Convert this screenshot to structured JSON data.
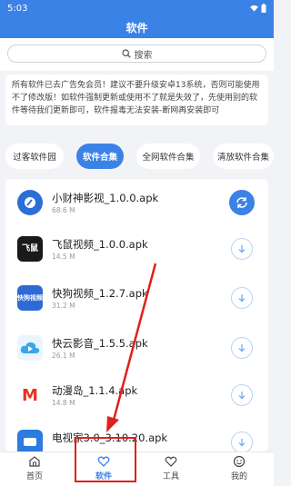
{
  "status_bar": {
    "time": "5:03"
  },
  "app_bar": {
    "title": "软件"
  },
  "search": {
    "placeholder": "搜索"
  },
  "notice": {
    "text": "所有软件已去广告免会员！建议不要升级安卓13系统，否则可能使用不了修改版！如软件强制更新或使用不了就是失效了，先使用别的软件等待我们更新即可，软件报毒无法安装-断网再安装即可"
  },
  "tabs": [
    {
      "label": "过客软件园"
    },
    {
      "label": "软件合集"
    },
    {
      "label": "全网软件合集"
    },
    {
      "label": "清放软件合集"
    }
  ],
  "apps": [
    {
      "name": "小财神影视_1.0.0.apk",
      "size": "68.6 M",
      "icon": "xiaocaishen-app-icon",
      "color": "#2b6fd6",
      "icon_text": "",
      "button": "sync"
    },
    {
      "name": "飞鼠视频_1.0.0.apk",
      "size": "14.5 M",
      "icon": "feishu-app-icon",
      "color": "#1a1a1a",
      "icon_text": "飞鼠",
      "button": "download"
    },
    {
      "name": "快狗视频_1.2.7.apk",
      "size": "31.2 M",
      "icon": "kuaigou-app-icon",
      "color": "#2d6ad3",
      "icon_text": "快狗视频",
      "button": "download"
    },
    {
      "name": "快云影音_1.5.5.apk",
      "size": "26.1 M",
      "icon": "kuaiyun-app-icon",
      "color": "#3aa7e8",
      "icon_text": "",
      "button": "download"
    },
    {
      "name": "动漫岛_1.1.4.apk",
      "size": "14.8 M",
      "icon": "dongmandao-app-icon",
      "color": "#e8341c",
      "icon_text": "M",
      "button": "download"
    },
    {
      "name": "电视家3.0_3.10.20.apk",
      "size": "",
      "icon": "dianshijia-app-icon",
      "color": "#2b7be0",
      "icon_text": "",
      "button": "download"
    }
  ],
  "bottom_nav": [
    {
      "label": "首页",
      "icon": "home-icon"
    },
    {
      "label": "软件",
      "icon": "heart-icon"
    },
    {
      "label": "工具",
      "icon": "heart-outline-icon"
    },
    {
      "label": "我的",
      "icon": "smiley-icon"
    }
  ],
  "colors": {
    "accent": "#3b82e6",
    "annotation": "#e0201b"
  }
}
